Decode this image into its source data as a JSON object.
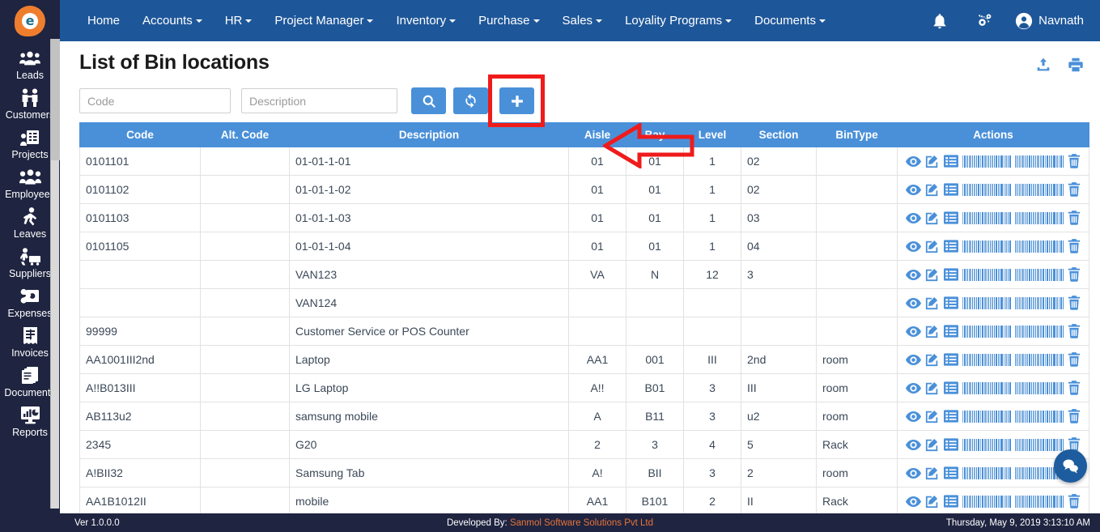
{
  "app": {
    "logo_letter": "e"
  },
  "sidebar": {
    "items": [
      {
        "label": "Leads",
        "icon": "leads-icon"
      },
      {
        "label": "Customers",
        "icon": "customers-icon"
      },
      {
        "label": "Projects",
        "icon": "projects-icon"
      },
      {
        "label": "Employees",
        "icon": "employees-icon"
      },
      {
        "label": "Leaves",
        "icon": "leaves-icon"
      },
      {
        "label": "Suppliers",
        "icon": "suppliers-icon"
      },
      {
        "label": "Expenses",
        "icon": "expenses-icon"
      },
      {
        "label": "Invoices",
        "icon": "invoices-icon"
      },
      {
        "label": "Documents",
        "icon": "documents-icon"
      },
      {
        "label": "Reports",
        "icon": "reports-icon"
      }
    ]
  },
  "topnav": {
    "items": [
      {
        "label": "Home",
        "has_caret": false
      },
      {
        "label": "Accounts",
        "has_caret": true
      },
      {
        "label": "HR",
        "has_caret": true
      },
      {
        "label": "Project Manager",
        "has_caret": true
      },
      {
        "label": "Inventory",
        "has_caret": true
      },
      {
        "label": "Purchase",
        "has_caret": true
      },
      {
        "label": "Sales",
        "has_caret": true
      },
      {
        "label": "Loyality Programs",
        "has_caret": true
      },
      {
        "label": "Documents",
        "has_caret": true
      }
    ],
    "notification_icon": "bell-icon",
    "settings_icon": "gears-icon",
    "user_name": "Navnath",
    "user_icon": "user-avatar-icon"
  },
  "page": {
    "title": "List of Bin locations",
    "export_icon": "upload-export-icon",
    "print_icon": "print-icon"
  },
  "filters": {
    "code": {
      "placeholder": "Code",
      "value": ""
    },
    "description": {
      "placeholder": "Description",
      "value": ""
    },
    "search_button": {
      "icon": "search-icon",
      "label": ""
    },
    "refresh_button": {
      "icon": "refresh-icon",
      "label": ""
    },
    "add_button": {
      "icon": "plus-icon",
      "label": ""
    }
  },
  "annotation": {
    "highlight_color": "#ef1b1b",
    "target": "add-new-bin-location-button",
    "shape": "left-pointing-arrow"
  },
  "table": {
    "columns": [
      "Code",
      "Alt. Code",
      "Description",
      "Aisle",
      "Bay",
      "Level",
      "Section",
      "BinType",
      "Actions"
    ],
    "row_actions": [
      "view-icon",
      "edit-icon",
      "details-icon",
      "barcode-icon",
      "delete-icon"
    ],
    "rows": [
      {
        "code": "0101101",
        "alt_code": "",
        "description": "01-01-1-01",
        "aisle": "01",
        "bay": "01",
        "level": "1",
        "section": "02",
        "bintype": ""
      },
      {
        "code": "0101102",
        "alt_code": "",
        "description": "01-01-1-02",
        "aisle": "01",
        "bay": "01",
        "level": "1",
        "section": "02",
        "bintype": ""
      },
      {
        "code": "0101103",
        "alt_code": "",
        "description": "01-01-1-03",
        "aisle": "01",
        "bay": "01",
        "level": "1",
        "section": "03",
        "bintype": ""
      },
      {
        "code": "0101105",
        "alt_code": "",
        "description": "01-01-1-04",
        "aisle": "01",
        "bay": "01",
        "level": "1",
        "section": "04",
        "bintype": ""
      },
      {
        "code": "",
        "alt_code": "",
        "description": "VAN123",
        "aisle": "VA",
        "bay": "N",
        "level": "12",
        "section": "3",
        "bintype": ""
      },
      {
        "code": "",
        "alt_code": "",
        "description": "VAN124",
        "aisle": "",
        "bay": "",
        "level": "",
        "section": "",
        "bintype": ""
      },
      {
        "code": "99999",
        "alt_code": "",
        "description": "Customer Service or POS Counter",
        "aisle": "",
        "bay": "",
        "level": "",
        "section": "",
        "bintype": ""
      },
      {
        "code": "AA1001III2nd",
        "alt_code": "",
        "description": "Laptop",
        "aisle": "AA1",
        "bay": "001",
        "level": "III",
        "section": "2nd",
        "bintype": "room"
      },
      {
        "code": "A!!B013III",
        "alt_code": "",
        "description": "LG Laptop",
        "aisle": "A!!",
        "bay": "B01",
        "level": "3",
        "section": "III",
        "bintype": "room"
      },
      {
        "code": "AB113u2",
        "alt_code": "",
        "description": "samsung mobile",
        "aisle": "A",
        "bay": "B11",
        "level": "3",
        "section": "u2",
        "bintype": "room"
      },
      {
        "code": "2345",
        "alt_code": "",
        "description": "G20",
        "aisle": "2",
        "bay": "3",
        "level": "4",
        "section": "5",
        "bintype": "Rack"
      },
      {
        "code": "A!BII32",
        "alt_code": "",
        "description": "Samsung Tab",
        "aisle": "A!",
        "bay": "BII",
        "level": "3",
        "section": "2",
        "bintype": "room"
      },
      {
        "code": "AA1B1012II",
        "alt_code": "",
        "description": "mobile",
        "aisle": "AA1",
        "bay": "B101",
        "level": "2",
        "section": "II",
        "bintype": "Rack"
      }
    ]
  },
  "chat": {
    "icon": "chat-bubble-icon"
  },
  "footer": {
    "version": "Ver 1.0.0.0",
    "developed_by_label": "Developed By:",
    "developer": "Sanmol Software Solutions Pvt Ltd",
    "datetime": "Thursday, May 9, 2019 3:13:10 AM"
  }
}
